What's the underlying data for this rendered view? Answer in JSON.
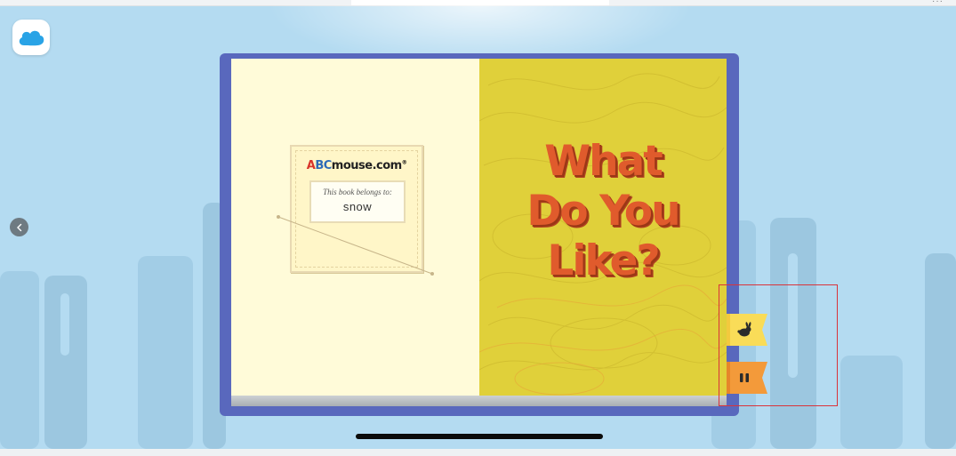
{
  "window": {
    "menu_dots": "···"
  },
  "book": {
    "title_lines": [
      "What",
      "Do You",
      "Like?"
    ],
    "bookplate": {
      "logo_a": "A",
      "logo_b": "BC",
      "logo_rest": "mouse.com",
      "logo_mark": "®",
      "caption": "This book belongs to:",
      "owner_name": "snow"
    },
    "page_color_left": "#fffbd9",
    "page_color_right": "#e0d03a",
    "title_color": "#e05b2c",
    "frame_color": "#5968bd"
  },
  "controls": {
    "home_icon": "cloud-icon",
    "prev_icon": "chevron-left-icon",
    "speed_icon": "rabbit-icon",
    "pause_icon": "pause-icon",
    "speed_flag_color": "#f9dc58",
    "pause_flag_color": "#f39a3a"
  },
  "annotation": {
    "highlight_color": "#d9333a"
  }
}
